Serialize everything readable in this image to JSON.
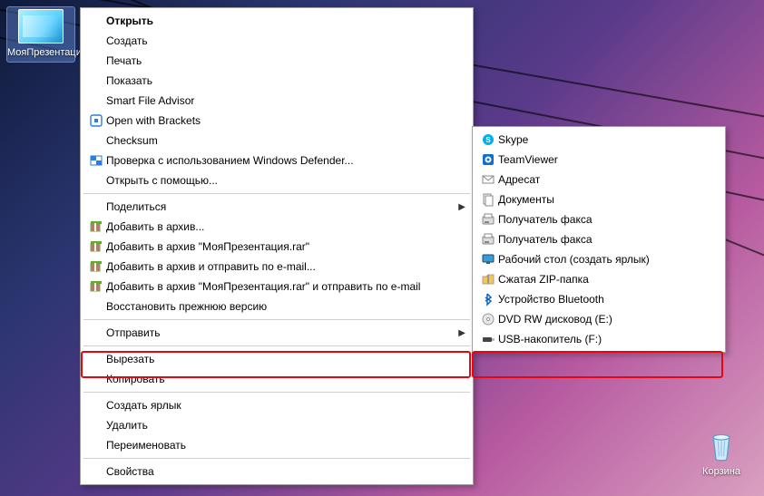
{
  "desktop": {
    "file_label": "МояПрезентация.pptx",
    "recycle_label": "Корзина"
  },
  "menu1": {
    "items": [
      {
        "label": "Открыть",
        "bold": true,
        "icon": ""
      },
      {
        "label": "Создать",
        "icon": ""
      },
      {
        "label": "Печать",
        "icon": ""
      },
      {
        "label": "Показать",
        "icon": ""
      },
      {
        "label": "Smart File Advisor",
        "icon": ""
      },
      {
        "label": "Open with Brackets",
        "icon": "brackets"
      },
      {
        "label": "Checksum",
        "icon": ""
      },
      {
        "label": "Проверка с использованием Windows Defender...",
        "icon": "defender"
      },
      {
        "label": "Открыть с помощью...",
        "icon": ""
      },
      {
        "sep": true
      },
      {
        "label": "Поделиться",
        "icon": "",
        "sub": true
      },
      {
        "label": "Добавить в архив...",
        "icon": "rar"
      },
      {
        "label": "Добавить в архив \"МояПрезентация.rar\"",
        "icon": "rar"
      },
      {
        "label": "Добавить в архив и отправить по e-mail...",
        "icon": "rar"
      },
      {
        "label": "Добавить в архив \"МояПрезентация.rar\" и отправить по e-mail",
        "icon": "rar"
      },
      {
        "label": "Восстановить прежнюю версию",
        "icon": ""
      },
      {
        "sep": true
      },
      {
        "label": "Отправить",
        "icon": "",
        "sub": true,
        "highlighted": true
      },
      {
        "sep": true
      },
      {
        "label": "Вырезать",
        "icon": ""
      },
      {
        "label": "Копировать",
        "icon": ""
      },
      {
        "sep": true
      },
      {
        "label": "Создать ярлык",
        "icon": ""
      },
      {
        "label": "Удалить",
        "icon": ""
      },
      {
        "label": "Переименовать",
        "icon": ""
      },
      {
        "sep": true
      },
      {
        "label": "Свойства",
        "icon": ""
      }
    ]
  },
  "menu2": {
    "items": [
      {
        "label": "Skype",
        "icon": "skype"
      },
      {
        "label": "TeamViewer",
        "icon": "tv"
      },
      {
        "label": "Адресат",
        "icon": "mail"
      },
      {
        "label": "Документы",
        "icon": "docs"
      },
      {
        "label": "Получатель факса",
        "icon": "fax"
      },
      {
        "label": "Получатель факса",
        "icon": "fax"
      },
      {
        "label": "Рабочий стол (создать ярлык)",
        "icon": "desk"
      },
      {
        "label": "Сжатая ZIP-папка",
        "icon": "zip"
      },
      {
        "label": "Устройство Bluetooth",
        "icon": "bt"
      },
      {
        "label": "DVD RW дисковод (E:)",
        "icon": "dvd"
      },
      {
        "label": "USB-накопитель (F:)",
        "icon": "usb",
        "highlighted": true
      }
    ]
  }
}
